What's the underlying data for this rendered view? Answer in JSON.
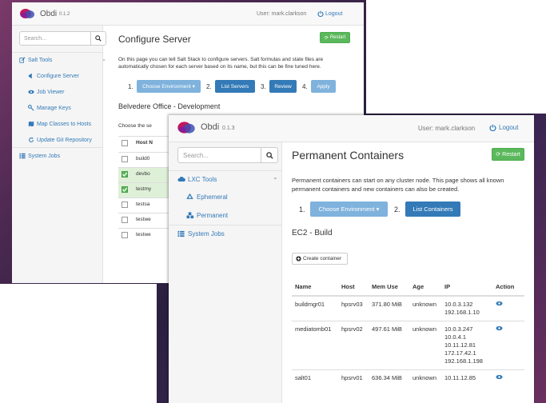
{
  "back": {
    "brand": "Obdi",
    "version": "0.1.2",
    "user": "User: mark.clarkson",
    "logout": "Logout",
    "search_placeholder": "Search...",
    "sidebar": {
      "group": "Salt Tools",
      "items": [
        "Configure Server",
        "Job Viewer",
        "Manage Keys",
        "Map Classes to Hosts",
        "Update Git Repository"
      ],
      "system": "System Jobs"
    },
    "title": "Configure Server",
    "restart": "Restart",
    "description": "On this page you can tell Salt Stack to configure servers. Salt formulas and state files are automatically chosen for each server based on its name, but this can be fine tuned here.",
    "steps": [
      {
        "num": "1.",
        "label": "Choose Environment ▾"
      },
      {
        "num": "2.",
        "label": "List Servers"
      },
      {
        "num": "3.",
        "label": "Review"
      },
      {
        "num": "4.",
        "label": "Apply"
      }
    ],
    "section": "Belvedere Office - Development",
    "choose_text": "Choose the se",
    "table_header": "Host N",
    "rows": [
      "build0",
      "devbo",
      "testmy",
      "testsa",
      "testwe",
      "testwe"
    ],
    "checked": [
      false,
      true,
      true,
      false,
      false,
      false
    ]
  },
  "front": {
    "brand": "Obdi",
    "version": "0.1.3",
    "user": "User: mark.clarkson",
    "logout": "Logout",
    "search_placeholder": "Search...",
    "sidebar": {
      "group": "LXC Tools",
      "items": [
        "Ephemeral",
        "Permanent"
      ],
      "system": "System Jobs"
    },
    "title": "Permanent Containers",
    "restart": "Restart",
    "description": "Permanent containers can start on any cluster node. This page shows all known permanent containers and new containers can also be created.",
    "steps": [
      {
        "num": "1.",
        "label": "Choose Environment ▾"
      },
      {
        "num": "2.",
        "label": "List Containers"
      }
    ],
    "section": "EC2 - Build",
    "create": "Create container",
    "columns": [
      "Name",
      "Host",
      "Mem Use",
      "Age",
      "IP",
      "Action"
    ],
    "rows": [
      {
        "name": "buildmgr01",
        "host": "hpsrv03",
        "mem": "371.80 MiB",
        "age": "unknown",
        "ip": [
          "10.0.3.132",
          "192.168.1.10"
        ]
      },
      {
        "name": "mediatomb01",
        "host": "hpsrv02",
        "mem": "497.61 MiB",
        "age": "unknown",
        "ip": [
          "10.0.3.247",
          "10.0.4.1",
          "10.11.12.81",
          "172.17.42.1",
          "192.168.1.198"
        ]
      },
      {
        "name": "salt01",
        "host": "hpsrv01",
        "mem": "636.34 MiB",
        "age": "unknown",
        "ip": [
          "10.11.12.85"
        ]
      }
    ]
  },
  "colors": {
    "primary": "#337ab7",
    "primary_light": "#7fb2dc",
    "success": "#5cb85c",
    "navbar_bg": "#f8f8f8",
    "sidebar_bg": "#f5f5f5",
    "selected_row": "#dff0d8"
  }
}
